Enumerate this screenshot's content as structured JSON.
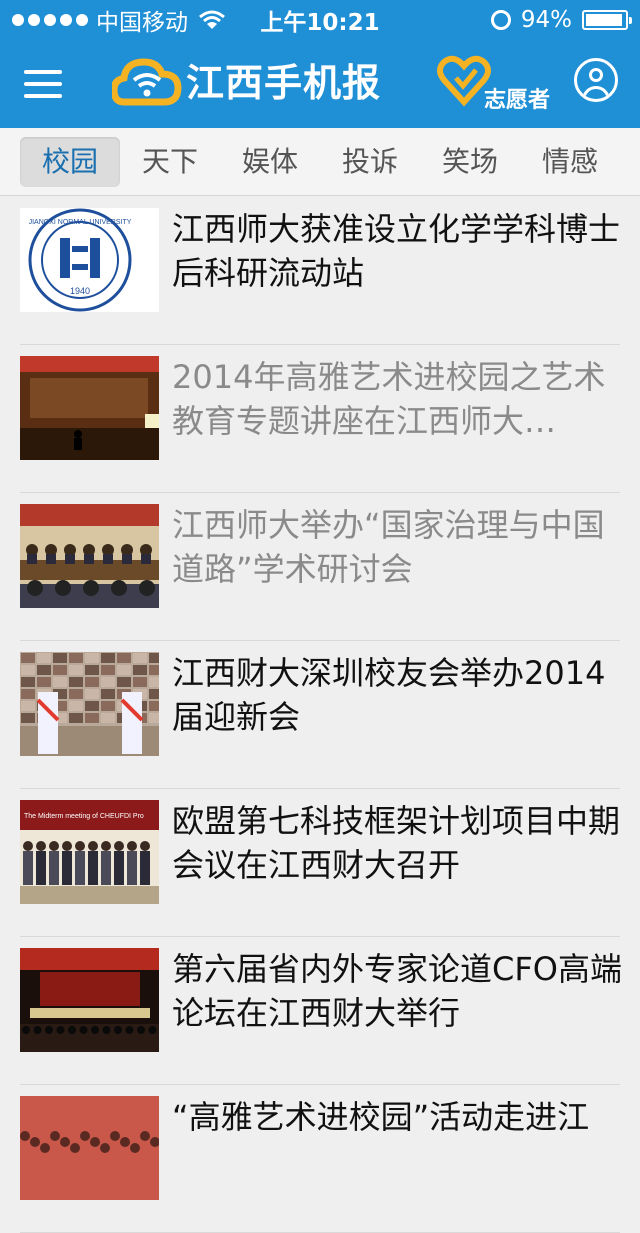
{
  "status_bar": {
    "carrier": "中国移动",
    "time": "上午10:21",
    "battery": "94%",
    "battery_level": 0.94
  },
  "header": {
    "logo_text": "江西手机报",
    "volunteer_label": "志愿者",
    "colors": {
      "bar": "#1f8fd6",
      "logo_accent": "#f5b324"
    }
  },
  "tabs": [
    {
      "label": "校园",
      "active": true
    },
    {
      "label": "天下",
      "active": false
    },
    {
      "label": "娱体",
      "active": false
    },
    {
      "label": "投诉",
      "active": false
    },
    {
      "label": "笑场",
      "active": false
    },
    {
      "label": "情感",
      "active": false
    }
  ],
  "news": [
    {
      "title": "江西师大获准设立化学学科博士后科研流动站",
      "read": false,
      "thumb": "university-logo",
      "thumb_text": "JIANGXI NORMAL UNIVERSITY",
      "thumb_year": "1940"
    },
    {
      "title": "2014年高雅艺术进校园之艺术教育专题讲座在江西师大…",
      "read": true,
      "thumb": "lecture-hall"
    },
    {
      "title": "江西师大举办“国家治理与中国道路”学术研讨会",
      "read": true,
      "thumb": "conference-panel"
    },
    {
      "title": "江西财大深圳校友会举办2014届迎新会",
      "read": false,
      "thumb": "welcome-event"
    },
    {
      "title": "欧盟第七科技框架计划项目中期会议在江西财大召开",
      "read": false,
      "thumb": "group-photo",
      "thumb_text": "The Midterm meeting of CHEUFDI Pro"
    },
    {
      "title": "第六届省内外专家论道CFO高端论坛在江西财大举行",
      "read": false,
      "thumb": "forum-stage"
    },
    {
      "title": "“高雅艺术进校园”活动走进江",
      "read": false,
      "thumb": "audience-crowd"
    }
  ]
}
